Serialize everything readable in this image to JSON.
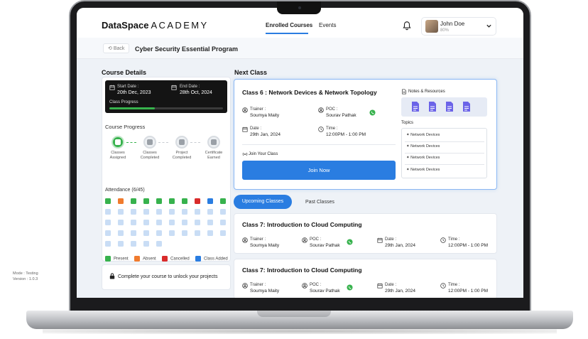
{
  "brand": {
    "name_bold": "DataSpace",
    "name_light": "ACADEMY"
  },
  "nav": {
    "tabs": [
      {
        "label": "Enrolled Courses",
        "active": true
      },
      {
        "label": "Events",
        "active": false
      }
    ]
  },
  "user": {
    "name": "John Doe",
    "progress": "80%"
  },
  "subheader": {
    "back_label": "Back",
    "page_title": "Cyber Security Essential Program"
  },
  "course_details": {
    "title": "Course Details",
    "start_label": "Start Date :",
    "start_value": "20th Dec, 2023",
    "end_label": "End Date :",
    "end_value": "28th Oct, 2024",
    "class_progress_label": "Class Progress",
    "class_progress_fraction": 0.4,
    "course_progress_title": "Course Progress",
    "steps": [
      {
        "label": "Classes Assigned",
        "done": true
      },
      {
        "label": "Classes Completed",
        "done": false
      },
      {
        "label": "Project Completed",
        "done": false
      },
      {
        "label": "Certificate Earned",
        "done": false
      }
    ],
    "attendance_title": "Attendance (6/45)",
    "attendance_row1": [
      "present",
      "absent",
      "present",
      "present",
      "present",
      "present",
      "present",
      "cancelled",
      "added",
      "present"
    ],
    "legend": [
      {
        "label": "Present",
        "color": "#37b24d"
      },
      {
        "label": "Absent",
        "color": "#f07b2e"
      },
      {
        "label": "Cancelled",
        "color": "#d92b2b"
      },
      {
        "label": "Class Added",
        "color": "#2a7de1"
      }
    ],
    "lock_text": "Complete your course to unlock your projects"
  },
  "footer_meta": {
    "mode": "Mode : Testing",
    "version": "Version : 1.0.3"
  },
  "next_class": {
    "section_title": "Next Class",
    "title": "Class 6 : Network Devices & Network Topology",
    "trainer_label": "Trainer :",
    "trainer_value": "Soumya Maity",
    "poc_label": "POC :",
    "poc_value": "Sourav Pathak",
    "date_label": "Date :",
    "date_value": "29th Jan, 2024",
    "time_label": "Time :",
    "time_value": "12:00PM - 1:00 PM",
    "join_label": "Join Your Class",
    "join_button": "Join Now",
    "notes_title": "Notes & Resources",
    "topics_title": "Topics",
    "topics": [
      "Network Devices",
      "Network Devices",
      "Network Devices",
      "Network Devices"
    ]
  },
  "class_tabs": {
    "upcoming": "Upcoming Classes",
    "past": "Past Classes"
  },
  "upcoming": [
    {
      "title": "Class 7: Introduction to Cloud Computing",
      "trainer_label": "Trainer :",
      "trainer": "Soumya Maity",
      "poc_label": "POC :",
      "poc": "Sourav Pathak",
      "date_label": "Date :",
      "date": "29th Jan, 2024",
      "time_label": "Time :",
      "time": "12:00PM - 1:00 PM"
    },
    {
      "title": "Class 7: Introduction to Cloud Computing",
      "trainer_label": "Trainer :",
      "trainer": "Soumya Maity",
      "poc_label": "POC :",
      "poc": "Sourav Pathak",
      "date_label": "Date :",
      "date": "29th Jan, 2024",
      "time_label": "Time :",
      "time": "12:00PM - 1:00 PM"
    }
  ],
  "colors": {
    "accent": "#2a7de1",
    "present": "#37b24d",
    "absent": "#f07b2e",
    "cancelled": "#d92b2b",
    "pending": "#c9ddf5"
  }
}
